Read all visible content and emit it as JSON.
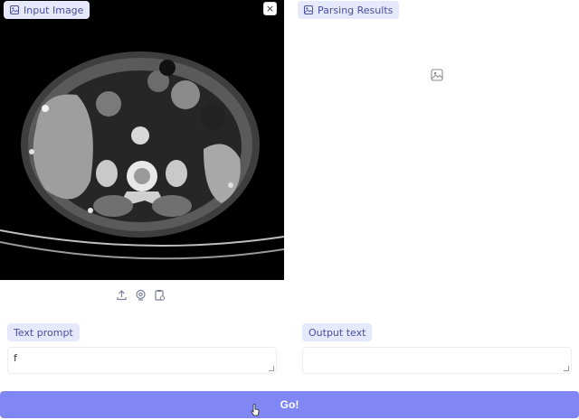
{
  "input_panel": {
    "label": "Input Image",
    "close_symbol": "×",
    "tools": [
      "upload-icon",
      "webcam-icon",
      "clipboard-icon"
    ]
  },
  "results_panel": {
    "label": "Parsing Results"
  },
  "prompt": {
    "label": "Text prompt",
    "value": "f"
  },
  "output": {
    "label": "Output text",
    "value": ""
  },
  "submit": {
    "label": "Go!"
  },
  "colors": {
    "chip_bg": "#e6e8fb",
    "chip_text": "#4b4f9e",
    "button_bg": "#8086f3"
  }
}
